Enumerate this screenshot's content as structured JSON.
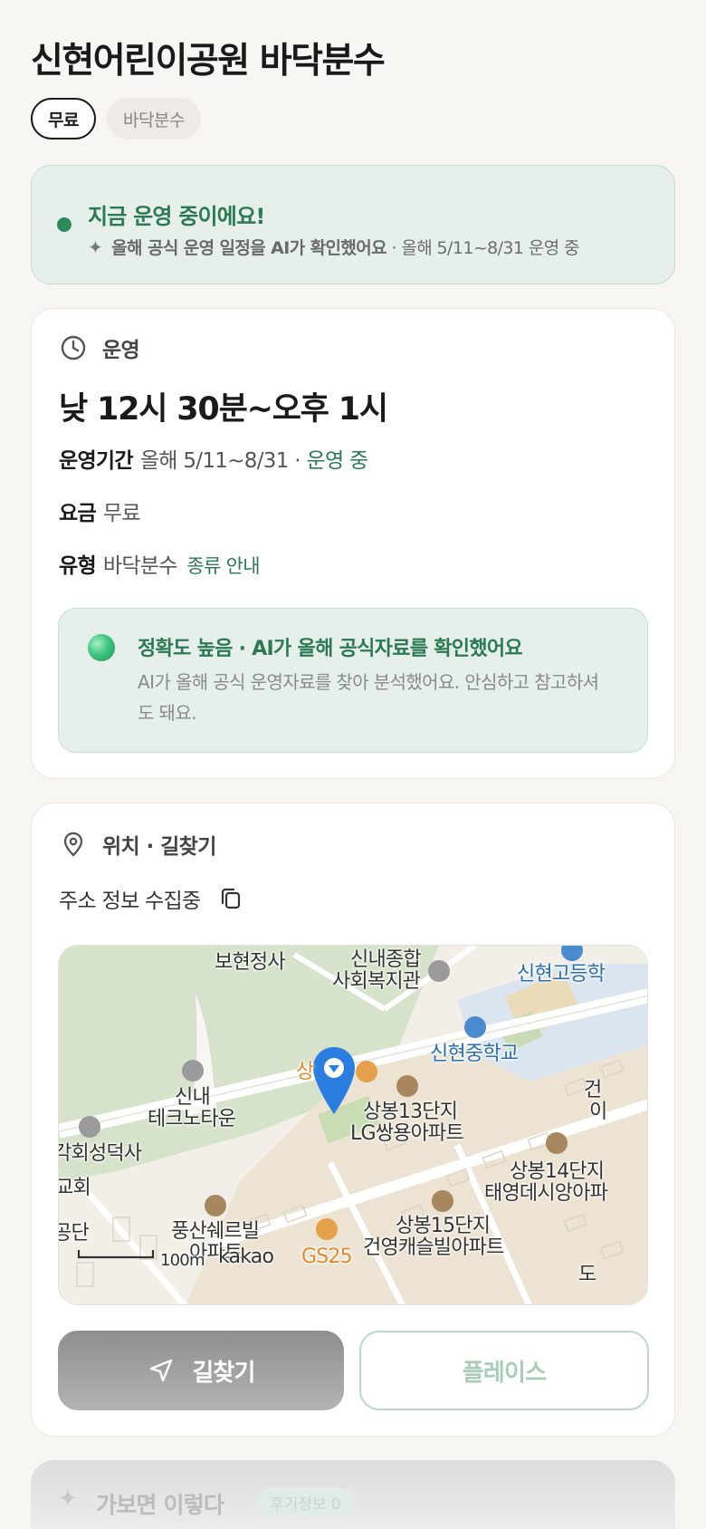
{
  "title": "신현어린이공원 바닥분수",
  "chips": {
    "fee": "무료",
    "type": "바닥분수"
  },
  "status": {
    "title": "지금 운영 중이에요!",
    "sub_bold": "올해 공식 운영 일정을 AI가 확인했어요",
    "sub_rest": " · 올해 5/11~8/31 운영 중",
    "accent_color": "#2b7a55"
  },
  "ops": {
    "section_label": "운영",
    "hours": "낮 12시 30분~오후 1시",
    "period_key": "운영기간",
    "period_value": "올해 5/11~8/31 · ",
    "period_status": "운영 중",
    "fee_key": "요금",
    "fee_value": "무료",
    "type_key": "유형",
    "type_value": "바닥분수",
    "type_link": "종류 안내",
    "ai_title": "정확도 높음 · AI가 올해 공식자료를 확인했어요",
    "ai_desc": "AI가 올해 공식 운영자료를 찾아 분석했어요. 안심하고 참고하셔도 돼요."
  },
  "location": {
    "section_label": "위치 · 길찾기",
    "address": "주소 정보 수집중",
    "map": {
      "labels": {
        "bohyeon": "보현정사",
        "sinnae_welfare_1": "신내종합",
        "sinnae_welfare_2": "사회복지관",
        "sinhyeon_high": "신현고등학",
        "sinhyeon_middle": "신현중학교",
        "sang": "상",
        "sangbong13_1": "상봉13단지",
        "sangbong13_2": "LG쌍용아파트",
        "sinnae_techno_1": "신내",
        "sinnae_techno_2": "테크노타운",
        "deoksa": "각회성덕사",
        "church": "교회",
        "gongdan": "공단",
        "pungsan_1": "풍산쉐르빌",
        "pungsan_2": "아파트",
        "gs25": "GS25",
        "sangbong15_1": "상봉15단지",
        "sangbong15_2": "건영캐슬빌아파트",
        "sangbong14_1": "상봉14단지",
        "sangbong14_2": "태영데시앙아파",
        "geon_1": "건",
        "geon_2": "이",
        "do": "도",
        "scale": "100m",
        "kakao": "kakao"
      }
    },
    "route_label": "길찾기",
    "place_label": "플레이스"
  },
  "next": {
    "title": "가보면 이렇다",
    "badge": "후기정보 0"
  }
}
